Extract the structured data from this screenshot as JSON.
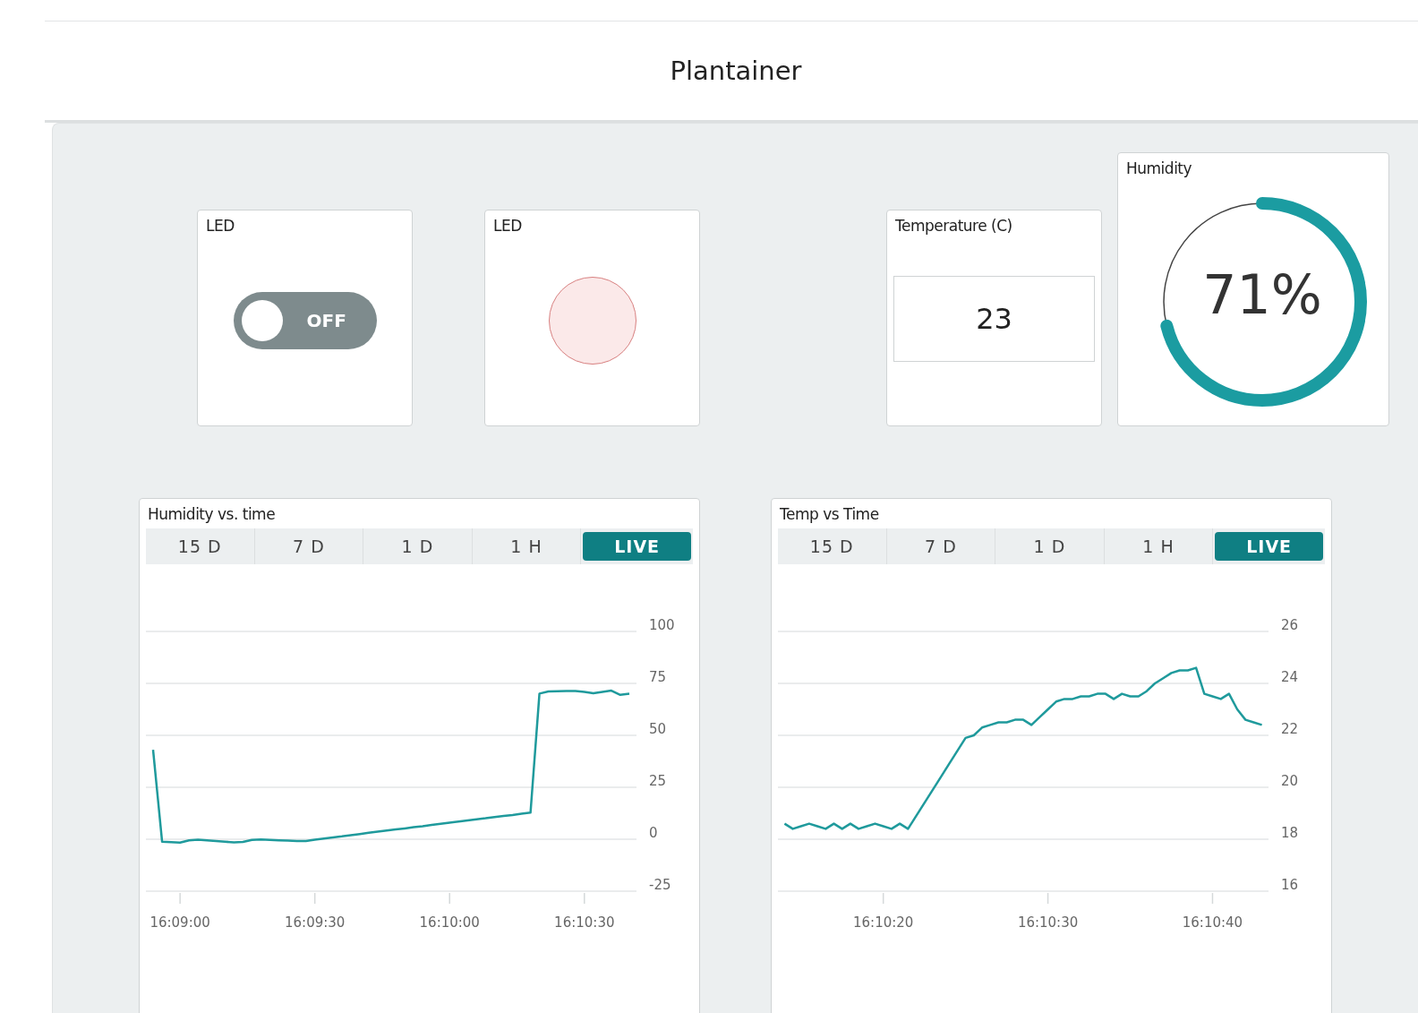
{
  "header": {
    "title": "Plantainer"
  },
  "widgets": [
    {
      "kind": "switch",
      "title": "LED",
      "on": false,
      "label": "OFF"
    },
    {
      "kind": "led",
      "title": "LED",
      "on": false
    },
    {
      "kind": "value",
      "title": "Temperature (C)",
      "value": "23"
    },
    {
      "kind": "gauge",
      "title": "Humidity",
      "value": "71%",
      "level": 0.71
    }
  ],
  "charts": [
    {
      "title": "Humidity vs. time",
      "tabs": [
        {
          "label": "15 D",
          "selected": false
        },
        {
          "label": "7 D",
          "selected": false
        },
        {
          "label": "1 D",
          "selected": false
        },
        {
          "label": "1 H",
          "selected": false
        },
        {
          "label": "LIVE",
          "selected": true
        }
      ],
      "chart_data": {
        "type": "line",
        "categories": [
          null,
          null,
          null,
          "16:09:00",
          null,
          null,
          null,
          null,
          null,
          null,
          null,
          null,
          null,
          null,
          null,
          null,
          null,
          null,
          "16:09:30",
          null,
          null,
          null,
          null,
          null,
          null,
          null,
          null,
          null,
          null,
          null,
          null,
          null,
          null,
          "16:10:00",
          null,
          null,
          null,
          null,
          null,
          null,
          null,
          null,
          null,
          null,
          null,
          null,
          null,
          null,
          "16:10:30",
          null,
          null,
          null,
          null,
          null
        ],
        "series": [
          {
            "color": "#1f9a9c",
            "values": [
              43,
              -1.2,
              -1.4,
              -1.6,
              -0.5,
              -0.2,
              -0.5,
              -0.8,
              -1.2,
              -1.5,
              -1.3,
              -0.3,
              -0.1,
              -0.3,
              -0.5,
              -0.7,
              -0.9,
              -0.8,
              -0.2,
              0.3,
              0.9,
              1.4,
              2.0,
              2.5,
              3.1,
              3.6,
              4.2,
              4.7,
              5.2,
              5.8,
              6.3,
              6.9,
              7.4,
              8.0,
              8.5,
              9.0,
              9.6,
              10.1,
              10.7,
              11.2,
              11.7,
              12.3,
              12.8,
              70.1,
              71.1,
              71.2,
              71.3,
              71.4,
              70.9,
              70.2,
              70.9,
              71.5,
              69.5,
              70.1
            ]
          }
        ],
        "grid": true,
        "ylim": [
          -25,
          100
        ],
        "yticks": [
          {
            "value": 100,
            "label": "100"
          },
          {
            "value": 75,
            "label": "75"
          },
          {
            "value": 50,
            "label": "50"
          },
          {
            "value": 25,
            "label": "25"
          },
          {
            "value": 0,
            "label": "0"
          },
          {
            "value": -25,
            "label": "-25"
          }
        ]
      }
    },
    {
      "title": "Temp vs Time",
      "tabs": [
        {
          "label": "15 D",
          "selected": false
        },
        {
          "label": "7 D",
          "selected": false
        },
        {
          "label": "1 D",
          "selected": false
        },
        {
          "label": "1 H",
          "selected": false
        },
        {
          "label": "LIVE",
          "selected": true
        }
      ],
      "chart_data": {
        "type": "line",
        "categories": [
          null,
          null,
          null,
          null,
          null,
          null,
          null,
          null,
          null,
          null,
          null,
          null,
          "16:10:20",
          null,
          null,
          null,
          null,
          null,
          null,
          null,
          null,
          null,
          null,
          null,
          null,
          null,
          null,
          null,
          null,
          null,
          null,
          null,
          "16:10:30",
          null,
          null,
          null,
          null,
          null,
          null,
          null,
          null,
          null,
          null,
          null,
          null,
          null,
          null,
          null,
          null,
          null,
          null,
          null,
          "16:10:40",
          null,
          null,
          null,
          null,
          null,
          null
        ],
        "series": [
          {
            "color": "#1f9a9c",
            "values": [
              18.6,
              18.4,
              18.5,
              18.6,
              18.5,
              18.4,
              18.6,
              18.4,
              18.6,
              18.4,
              18.5,
              18.6,
              18.5,
              18.4,
              18.6,
              18.4,
              18.9,
              19.4,
              19.9,
              20.4,
              20.9,
              21.4,
              21.9,
              22.0,
              22.3,
              22.4,
              22.5,
              22.5,
              22.6,
              22.6,
              22.4,
              22.7,
              23.0,
              23.3,
              23.4,
              23.4,
              23.5,
              23.5,
              23.6,
              23.6,
              23.4,
              23.6,
              23.5,
              23.5,
              23.7,
              24.0,
              24.2,
              24.4,
              24.5,
              24.5,
              24.6,
              23.6,
              23.5,
              23.4,
              23.6,
              23.0,
              22.6,
              22.5,
              22.4
            ]
          }
        ],
        "grid": true,
        "ylim": [
          16,
          26
        ],
        "yticks": [
          {
            "value": 26,
            "label": "26"
          },
          {
            "value": 24,
            "label": "24"
          },
          {
            "value": 22,
            "label": "22"
          },
          {
            "value": 20,
            "label": "20"
          },
          {
            "value": 18,
            "label": "18"
          },
          {
            "value": 16,
            "label": "16"
          }
        ]
      }
    }
  ]
}
